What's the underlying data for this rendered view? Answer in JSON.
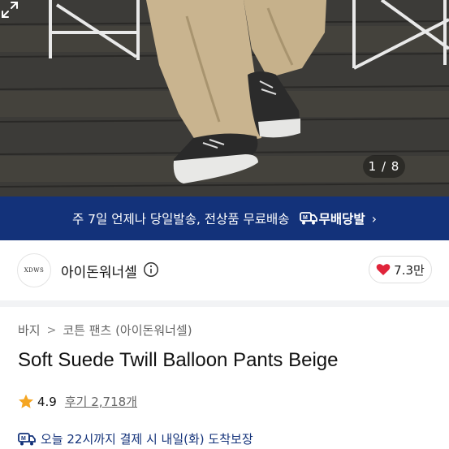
{
  "hero": {
    "counter": "1 / 8"
  },
  "banner": {
    "text": "주 7일 언제나 당일발송, 전상품 무료배송",
    "badge_label": "무배당발",
    "chevron": "›"
  },
  "shop": {
    "logo_text": "XDWS",
    "name": "아이돈워너셀",
    "like_count": "7.3만"
  },
  "breadcrumb": {
    "items": [
      "바지",
      "코튼 팬츠 (아이돈워너셀)"
    ],
    "separator": ">"
  },
  "product": {
    "title": "Soft Suede Twill Balloon Pants Beige",
    "rating": "4.9",
    "reviews_label": "후기 2,718개"
  },
  "delivery": {
    "text": "오늘 22시까지 결제 시 내일(화) 도착보장"
  },
  "icons": {
    "expand": "expand-icon",
    "info": "info-icon",
    "heart": "heart-icon",
    "star": "star-icon",
    "truck": "truck-icon"
  },
  "colors": {
    "banner_bg": "#13327a",
    "heart": "#e0243a",
    "star": "#f5a623"
  }
}
